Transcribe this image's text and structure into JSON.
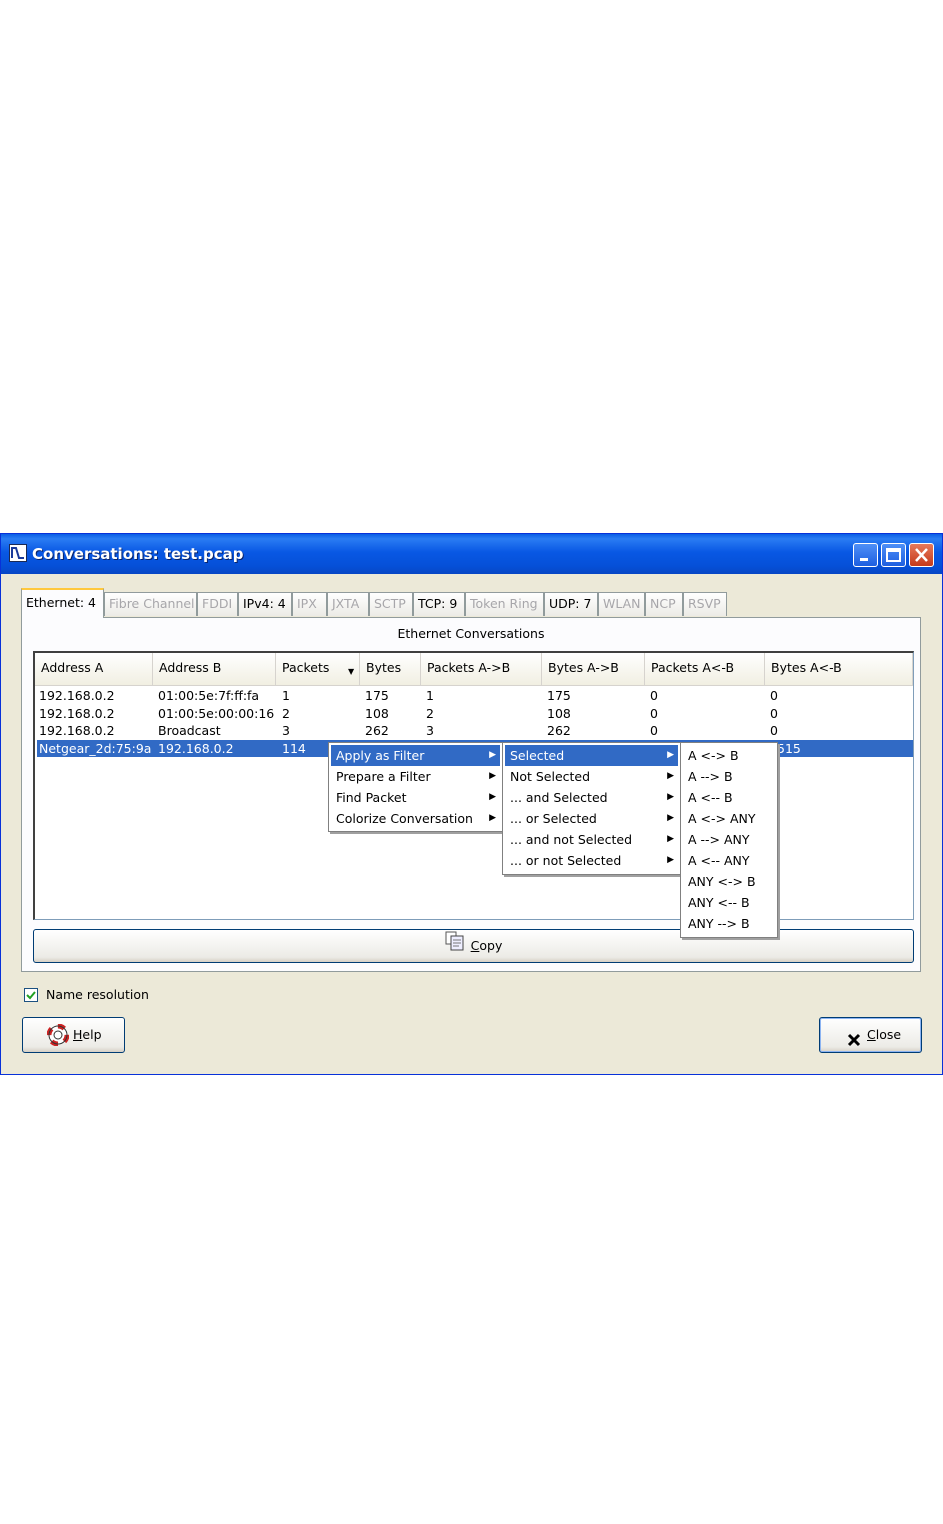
{
  "window": {
    "title": "Conversations: test.pcap",
    "icon": "wireshark-app-icon",
    "controls": [
      "minimize-icon",
      "maximize-icon",
      "close-icon"
    ]
  },
  "tabs": [
    {
      "label": "Ethernet: 4",
      "state": "active"
    },
    {
      "label": "Fibre Channel",
      "state": "disabled"
    },
    {
      "label": "FDDI",
      "state": "disabled"
    },
    {
      "label": "IPv4: 4",
      "state": "enabled"
    },
    {
      "label": "IPX",
      "state": "disabled"
    },
    {
      "label": "JXTA",
      "state": "disabled"
    },
    {
      "label": "SCTP",
      "state": "disabled"
    },
    {
      "label": "TCP: 9",
      "state": "enabled"
    },
    {
      "label": "Token Ring",
      "state": "disabled"
    },
    {
      "label": "UDP: 7",
      "state": "enabled"
    },
    {
      "label": "WLAN",
      "state": "disabled"
    },
    {
      "label": "NCP",
      "state": "disabled"
    },
    {
      "label": "RSVP",
      "state": "disabled"
    }
  ],
  "panel": {
    "title": "Ethernet Conversations"
  },
  "table": {
    "columns": [
      "Address A",
      "Address B",
      "Packets",
      "Bytes",
      "Packets A->B",
      "Bytes A->B",
      "Packets A<-B",
      "Bytes A<-B"
    ],
    "sort_column": "Packets",
    "rows": [
      [
        "192.168.0.2",
        "01:00:5e:7f:ff:fa",
        "1",
        "175",
        "1",
        "175",
        "0",
        "0"
      ],
      [
        "192.168.0.2",
        "01:00:5e:00:00:16",
        "2",
        "108",
        "2",
        "108",
        "0",
        "0"
      ],
      [
        "192.168.0.2",
        "Broadcast",
        "3",
        "262",
        "3",
        "262",
        "0",
        "0"
      ],
      [
        "Netgear_2d:75:9a",
        "192.168.0.2",
        "114",
        "",
        "",
        "",
        "",
        "515"
      ]
    ],
    "selected_row": 3
  },
  "buttons": {
    "copy_pre": "",
    "copy_accel": "C",
    "copy_post": "opy",
    "help_accel": "H",
    "help_post": "elp",
    "close_accel": "C",
    "close_post": "lose"
  },
  "name_resolution": {
    "label": "Name resolution",
    "checked": true
  },
  "context_menu": {
    "level1": [
      {
        "label": "Apply as Filter",
        "highlighted": true,
        "submenu": true
      },
      {
        "label": "Prepare a Filter",
        "submenu": true
      },
      {
        "label": "Find Packet",
        "submenu": true
      },
      {
        "label": "Colorize Conversation",
        "submenu": true
      }
    ],
    "level2": [
      {
        "label": "Selected",
        "highlighted": true,
        "submenu": true
      },
      {
        "label": "Not Selected",
        "submenu": true
      },
      {
        "label": "... and Selected",
        "submenu": true
      },
      {
        "label": "... or Selected",
        "submenu": true
      },
      {
        "label": "... and not Selected",
        "submenu": true
      },
      {
        "label": "... or not Selected",
        "submenu": true
      }
    ],
    "level3": [
      {
        "label": "A <-> B"
      },
      {
        "label": "A --> B"
      },
      {
        "label": "A <-- B"
      },
      {
        "label": "A <-> ANY"
      },
      {
        "label": "A --> ANY"
      },
      {
        "label": "A <-- ANY"
      },
      {
        "label": "ANY <-> B"
      },
      {
        "label": "ANY <-- B"
      },
      {
        "label": "ANY --> B"
      }
    ]
  },
  "colors": {
    "titlebar": "#0a5ee6",
    "selection": "#316ac5",
    "tab_active_accent": "#ffc83c",
    "dialog_bg": "#ece9d8"
  }
}
